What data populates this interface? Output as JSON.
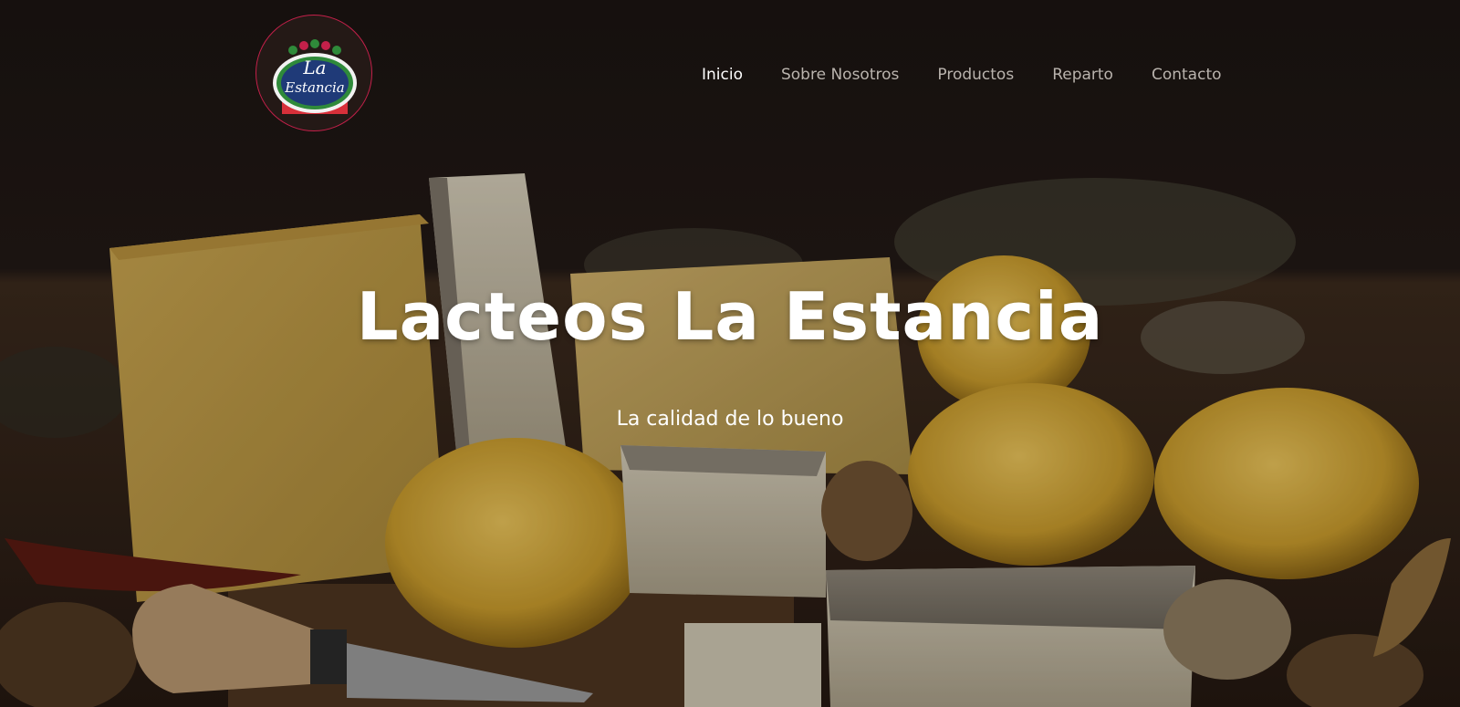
{
  "brand": {
    "logo_text_line1": "La",
    "logo_text_line2": "Estancia",
    "logo_colors": {
      "ring": "#c4204a",
      "oval": "#1f3a78",
      "oval_border": "#2f8a3a",
      "band": "#d7303a"
    }
  },
  "nav": {
    "items": [
      {
        "label": "Inicio",
        "active": true
      },
      {
        "label": "Sobre Nosotros",
        "active": false
      },
      {
        "label": "Productos",
        "active": false
      },
      {
        "label": "Reparto",
        "active": false
      },
      {
        "label": "Contacto",
        "active": false
      }
    ],
    "colors": {
      "active": "#ffffff",
      "inactive": "#b9b3ad"
    }
  },
  "hero": {
    "title": "Lacteos La Estancia",
    "subtitle": "La calidad de lo bueno",
    "background_image": "cheese-assortment-photo"
  }
}
